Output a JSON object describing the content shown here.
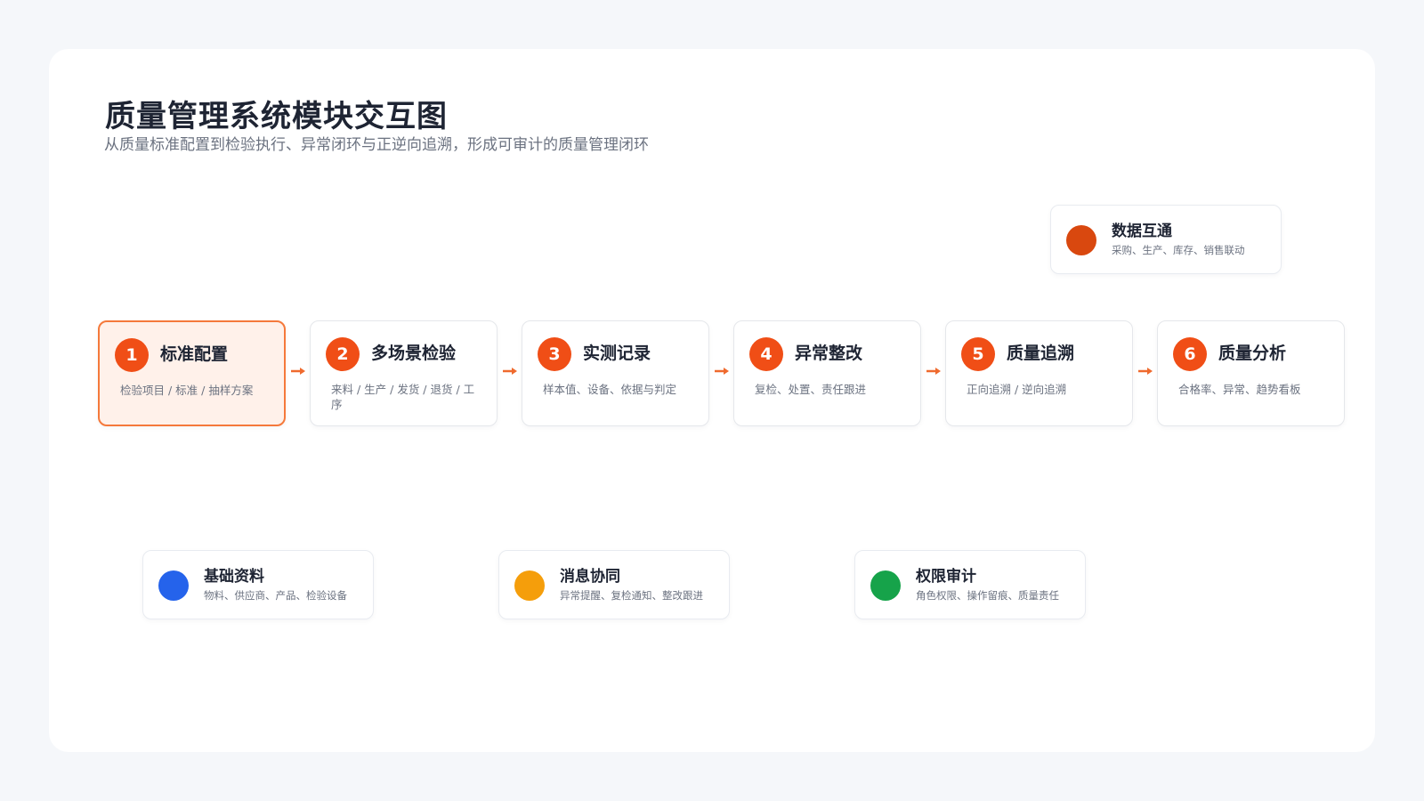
{
  "title": "质量管理系统模块交互图",
  "subtitle": "从质量标准配置到检验执行、异常闭环与正逆向追溯，形成可审计的质量管理闭环",
  "data_hub": {
    "name": "数据互通",
    "desc": "采购、生产、库存、销售联动",
    "color": "#d9480f"
  },
  "steps": [
    {
      "num": "1",
      "label": "标准配置",
      "desc": "检验项目 / 标准 / 抽样方案",
      "active": true
    },
    {
      "num": "2",
      "label": "多场景检验",
      "desc": "来料 / 生产 / 发货 / 退货 / 工序"
    },
    {
      "num": "3",
      "label": "实测记录",
      "desc": "样本值、设备、依据与判定"
    },
    {
      "num": "4",
      "label": "异常整改",
      "desc": "复检、处置、责任跟进"
    },
    {
      "num": "5",
      "label": "质量追溯",
      "desc": "正向追溯 / 逆向追溯"
    },
    {
      "num": "6",
      "label": "质量分析",
      "desc": "合格率、异常、趋势看板"
    }
  ],
  "support_modules": [
    {
      "name": "基础资料",
      "desc": "物料、供应商、产品、检验设备",
      "color": "#2563eb"
    },
    {
      "name": "消息协同",
      "desc": "异常提醒、复检通知、整改跟进",
      "color": "#f59e0b"
    },
    {
      "name": "权限审计",
      "desc": "角色权限、操作留痕、质量责任",
      "color": "#16a34a"
    }
  ],
  "colors": {
    "accent": "#f04e16",
    "active_bg": "#fff1ea",
    "active_border": "#f5793b",
    "arrow": "#ef6a2e"
  }
}
